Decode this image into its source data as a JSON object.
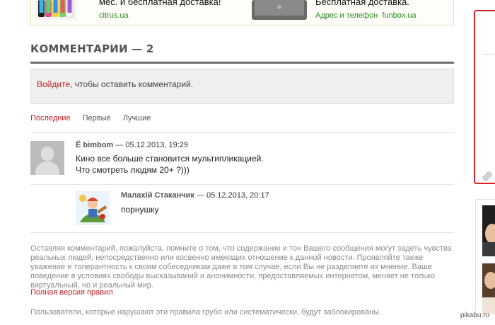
{
  "ads": [
    {
      "title": "мес. и бесплатная доставка!",
      "url": "citrus.ua",
      "thumb": "phones-image"
    },
    {
      "title": "Бесплатная доставка.",
      "url_label": "Адрес и телефон",
      "url": "funbox.ua",
      "thumb": "laptop-image"
    }
  ],
  "comments_section": {
    "title": "КОММЕНТАРИИ — 2",
    "login": {
      "link": "Войдите",
      "text": ", чтобы оставить комментарий."
    },
    "sort_tabs": [
      {
        "label": "Последние",
        "active": true
      },
      {
        "label": "Первые",
        "active": false
      },
      {
        "label": "Лучшие",
        "active": false
      }
    ],
    "comments": [
      {
        "author": "Ё bimbom",
        "separator": " — ",
        "date": "05.12.2013, 19:29",
        "lines": [
          "Кино все больше становится мультипликацией.",
          "Что смотреть людям 20+ ?)))"
        ],
        "avatar": "default-avatar"
      },
      {
        "author": "Малахій Стаканчик",
        "separator": " — ",
        "date": "05.12.2013, 20:17",
        "lines": [
          "порнушку"
        ],
        "avatar": "cartoon-avatar",
        "reply": true
      }
    ],
    "rules_text": "Оставляя комментарий, пожалуйста, помните о том, что содержание и тон Вашего сообщения могут задеть чувства реальных людей, непосредственно или косвенно имеющих отношение к данной новости. Проявляйте также уважение и толерантность к своим собеседникам даже в том случае, если Вы не разделяете их мнение. Ваше поведение в условиях свободы высказываний и анонимности, предоставляемых интернетом, меняет не только виртуальный, но и реальный мир.",
    "rules_link": "Полная версия правил",
    "banned_text": "Пользователи, которые нарушают эти правила грубо или систематически, будут заблокированы."
  },
  "watermark": "pikabu.ru",
  "colors": {
    "accent_red": "#c21f24",
    "ad_url_green": "#2b8a1d",
    "sidebar_red": "#d8232a"
  }
}
